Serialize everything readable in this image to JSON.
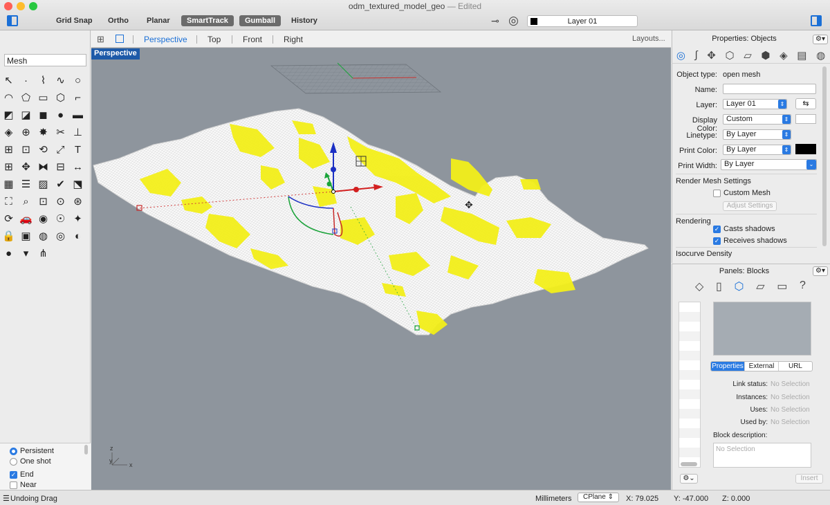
{
  "window": {
    "title": "odm_textured_model_geo",
    "edited": "— Edited"
  },
  "toolbar": {
    "buttons": [
      "Grid Snap",
      "Ortho",
      "Planar",
      "SmartTrack",
      "Gumball",
      "History"
    ],
    "active_buttons": [
      "SmartTrack",
      "Gumball"
    ],
    "layer": "Layer 01"
  },
  "command": {
    "value": "Mesh"
  },
  "tools": [
    "pointer-arrow-icon",
    "point-icon",
    "polyline-icon",
    "curve-icon",
    "circle-icon",
    "arc-icon",
    "polygon-icon",
    "rectangle-icon",
    "hexagon-icon",
    "fillet-icon",
    "surface-icon",
    "patch-icon",
    "box-icon",
    "sphere-icon",
    "cylinder-icon",
    "mesh-icon",
    "boolean-icon",
    "explode-icon",
    "trim-icon",
    "split-icon",
    "join-icon",
    "group-icon",
    "rotate-icon",
    "scale-icon",
    "text-icon",
    "array-icon",
    "move-icon",
    "mirror-icon",
    "align-icon",
    "dimension-icon",
    "grid-icon",
    "layer-icon",
    "hatch-icon",
    "check-icon",
    "project-icon",
    "paint-icon",
    "zoom-icon",
    "zoom-window-icon",
    "zoom-extents-icon",
    "zoom-selected-icon",
    "undo-view-icon",
    "car-icon",
    "camera-icon",
    "bulb-icon",
    "light-icon",
    "lock-icon",
    "book-icon",
    "color-wheel-icon",
    "render-sphere-icon",
    "render-icon",
    "sphere-small-icon",
    "dropdown-icon",
    "network-icon"
  ],
  "tool_glyphs": [
    "↖",
    "·",
    "⌇",
    "∿",
    "○",
    "◠",
    "⬠",
    "▭",
    "⬡",
    "⌐",
    "◩",
    "◪",
    "◼",
    "●",
    "▬",
    "◈",
    "⊕",
    "✸",
    "✂",
    "⊥",
    "⊞",
    "⊡",
    "⟲",
    "⤢",
    "T",
    "⊞",
    "✥",
    "⧓",
    "⊟",
    "↔",
    "▦",
    "☰",
    "▨",
    "✔",
    "⬔",
    "⛶",
    "⌕",
    "⊡",
    "⊙",
    "⊛",
    "⟳",
    "🚗",
    "◉",
    "☉",
    "✦",
    "🔒",
    "▣",
    "◍",
    "◎",
    "◐",
    "●",
    "▾",
    "⋔"
  ],
  "osnap": {
    "persistent": "Persistent",
    "one_shot": "One shot",
    "end": "End",
    "near": "Near",
    "selected_mode": "Persistent"
  },
  "viewport_tabs": {
    "items": [
      "Perspective",
      "Top",
      "Front",
      "Right"
    ],
    "selected": "Perspective",
    "layouts": "Layouts..."
  },
  "viewport": {
    "label": "Perspective",
    "axis_x": "x",
    "axis_y": "y",
    "axis_z": "z"
  },
  "properties": {
    "title": "Properties: Objects",
    "object_type_label": "Object type:",
    "object_type": "open mesh",
    "name_label": "Name:",
    "name": "",
    "layer_label": "Layer:",
    "layer": "Layer 01",
    "display_color_label": "Display Color:",
    "display_color": "Custom",
    "linetype_label": "Linetype:",
    "linetype": "By Layer",
    "print_color_label": "Print Color:",
    "print_color": "By Layer",
    "print_width_label": "Print Width:",
    "print_width": "By Layer",
    "render_mesh_settings": "Render Mesh Settings",
    "custom_mesh": "Custom Mesh",
    "adjust_settings": "Adjust Settings",
    "rendering": "Rendering",
    "casts_shadows": "Casts shadows",
    "receives_shadows": "Receives shadows",
    "isocurve_density": "Isocurve Density"
  },
  "blocks": {
    "title": "Panels: Blocks",
    "tabs": [
      "Properties",
      "External",
      "URL"
    ],
    "selected_tab": "Properties",
    "link_status_label": "Link status:",
    "instances_label": "Instances:",
    "uses_label": "Uses:",
    "used_by_label": "Used by:",
    "no_selection": "No Selection",
    "block_description": "Block description:",
    "insert": "Insert"
  },
  "status": {
    "message": "Undoing Drag",
    "units": "Millimeters",
    "cplane": "CPlane",
    "x": "X: 79.025",
    "y": "Y: -47.000",
    "z": "Z: 0.000"
  },
  "colors": {
    "accent": "#2a7ae2",
    "mesh_highlight": "#f3ef1a",
    "viewport_bg": "#8e959d"
  }
}
